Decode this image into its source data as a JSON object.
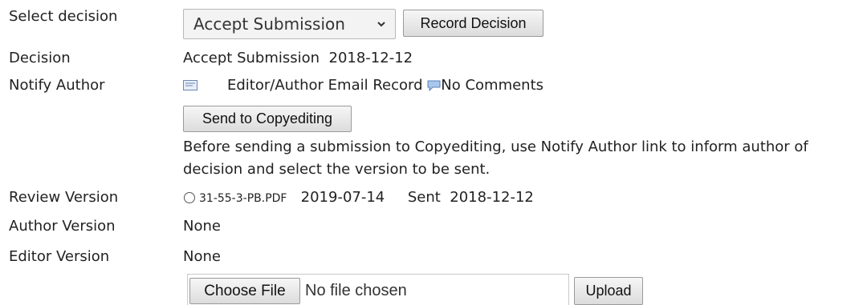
{
  "decision_select": {
    "label": "Select decision",
    "selected": "Accept Submission",
    "record_button": "Record Decision"
  },
  "decision": {
    "label": "Decision",
    "value": "Accept Submission",
    "date": "2018-12-12"
  },
  "notify": {
    "label": "Notify Author",
    "email_link": "Editor/Author Email Record",
    "comments_link": "No Comments"
  },
  "copyedit": {
    "button": "Send to Copyediting",
    "note": "Before sending a submission to Copyediting, use Notify Author link to inform author of decision and select the version to be sent."
  },
  "review_version": {
    "label": "Review Version",
    "file": "31-55-3-PB.PDF",
    "date": "2019-07-14",
    "sent_label": "Sent",
    "sent_date": "2018-12-12"
  },
  "author_version": {
    "label": "Author Version",
    "value": "None"
  },
  "editor_version": {
    "label": "Editor Version",
    "value": "None"
  },
  "upload": {
    "choose_button": "Choose File",
    "no_file": "No file chosen",
    "upload_button": "Upload"
  },
  "icons": {
    "mail": "mail-icon",
    "comment": "comment-icon",
    "chevron": "chevron-down-icon"
  },
  "colors": {
    "text": "#222222",
    "button_border": "#9a9a9a",
    "button_bg": "#e6e6e6"
  }
}
